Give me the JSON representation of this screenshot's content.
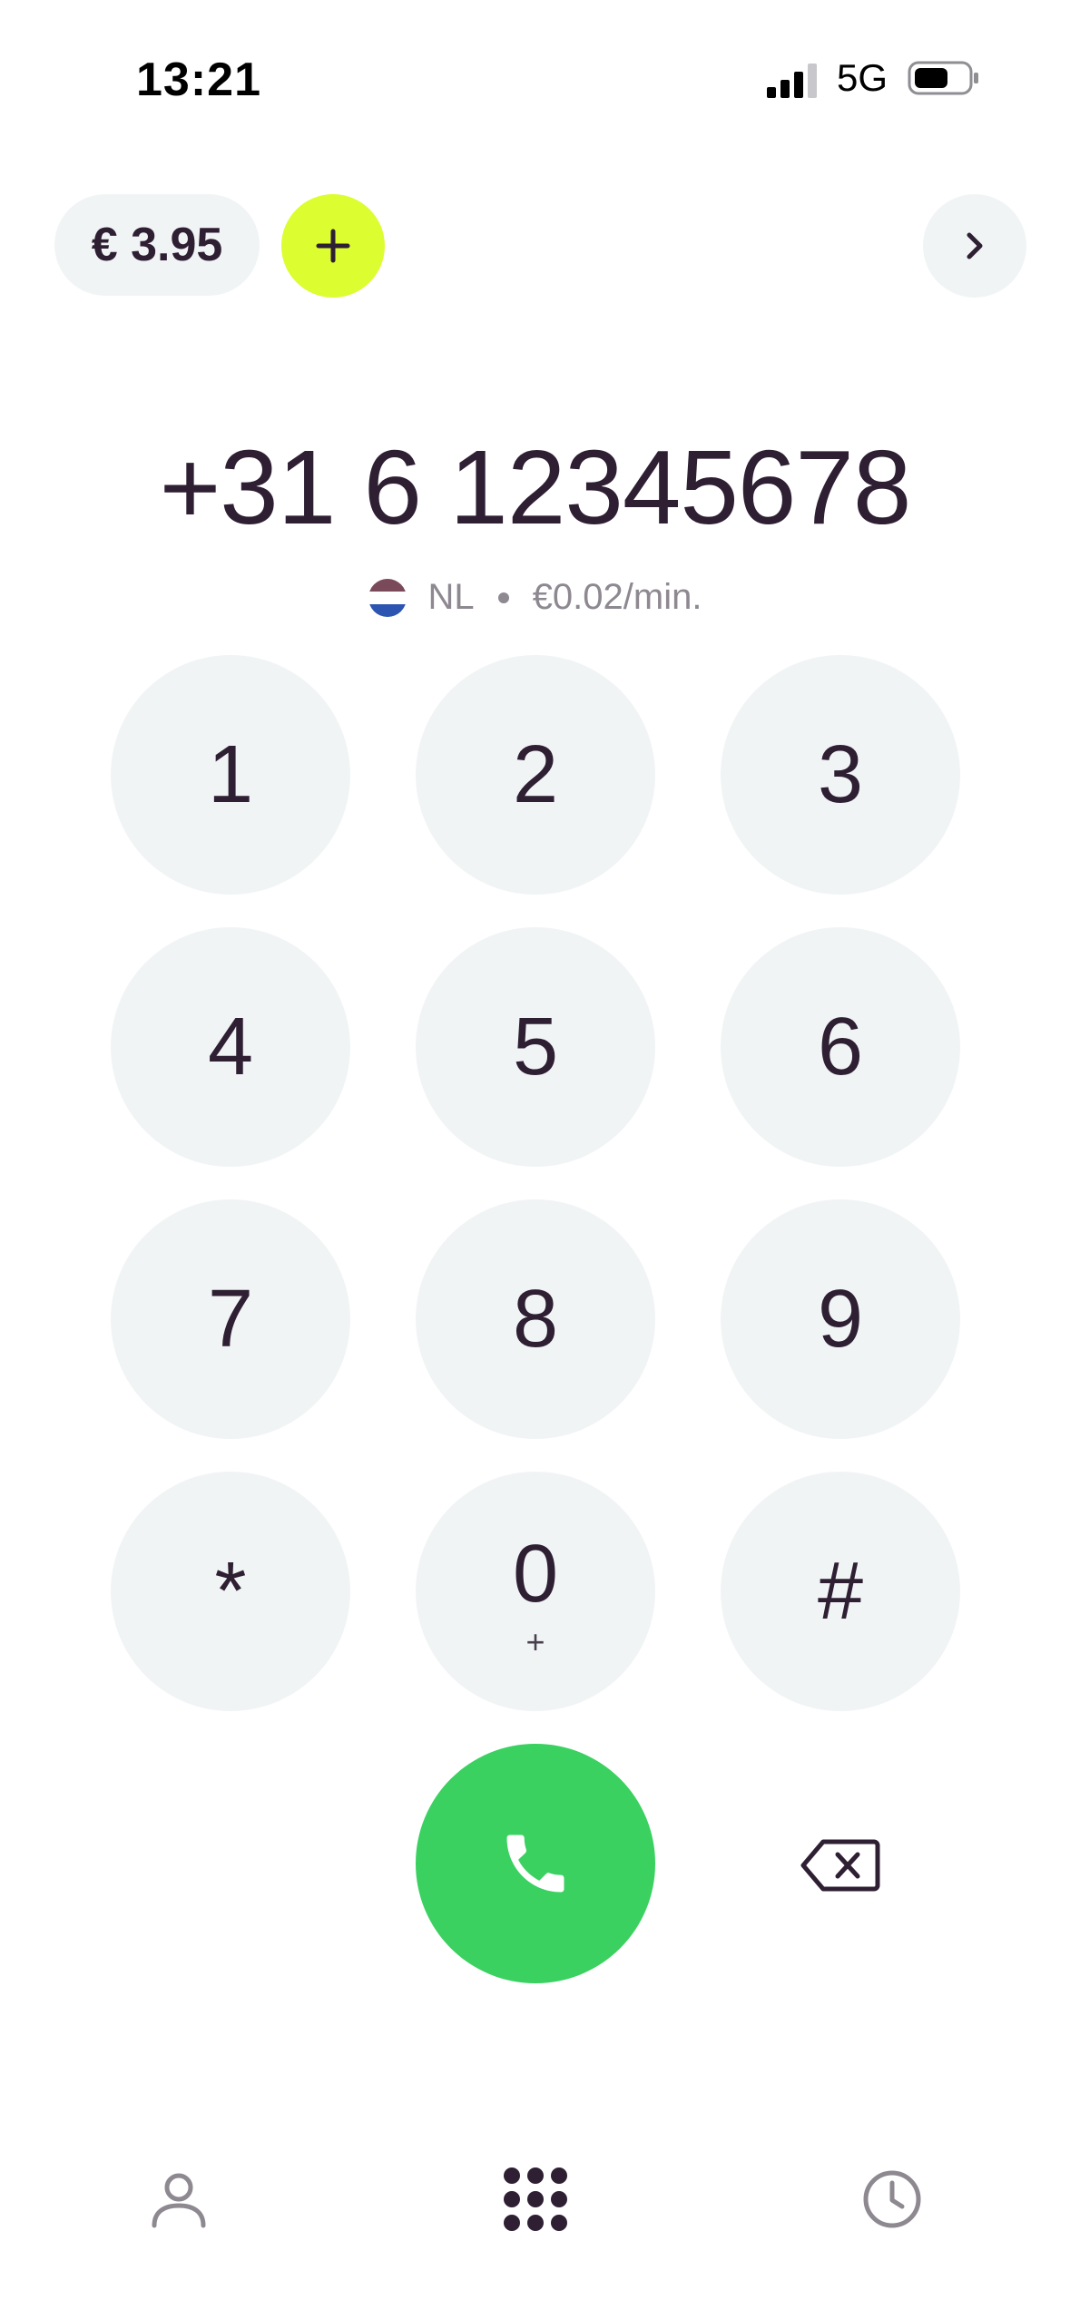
{
  "status_bar": {
    "time": "13:21",
    "network": "5G",
    "icons": [
      "signal-icon",
      "battery-icon"
    ]
  },
  "header": {
    "balance": "€ 3.95",
    "topup_icon": "plus-icon",
    "next_icon": "chevron-right-icon",
    "accent_color": "#dcfd30"
  },
  "dialer": {
    "number": "+31 6 12345678",
    "country_code": "NL",
    "rate": "€0.02/min.",
    "flag_icon": "netherlands-flag-icon"
  },
  "keypad": {
    "keys": [
      {
        "digit": "1",
        "sub": ""
      },
      {
        "digit": "2",
        "sub": ""
      },
      {
        "digit": "3",
        "sub": ""
      },
      {
        "digit": "4",
        "sub": ""
      },
      {
        "digit": "5",
        "sub": ""
      },
      {
        "digit": "6",
        "sub": ""
      },
      {
        "digit": "7",
        "sub": ""
      },
      {
        "digit": "8",
        "sub": ""
      },
      {
        "digit": "9",
        "sub": ""
      },
      {
        "digit": "*",
        "sub": ""
      },
      {
        "digit": "0",
        "sub": "+"
      },
      {
        "digit": "#",
        "sub": ""
      }
    ],
    "call_icon": "phone-icon",
    "call_color": "#3ad160",
    "backspace_icon": "backspace-icon"
  },
  "tab_bar": {
    "tabs": [
      {
        "icon": "contacts-icon",
        "active": false
      },
      {
        "icon": "keypad-icon",
        "active": true
      },
      {
        "icon": "history-icon",
        "active": false
      }
    ]
  }
}
